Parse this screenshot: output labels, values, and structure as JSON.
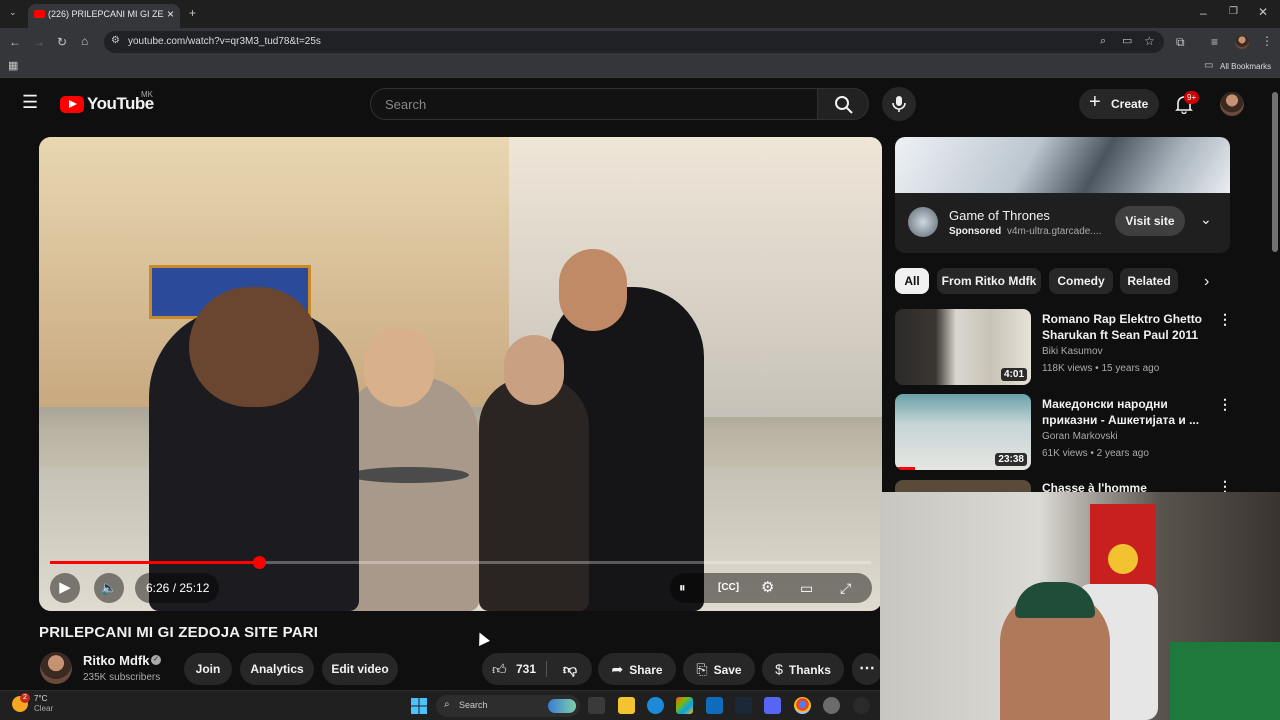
{
  "browser": {
    "tab_title": "(226) PRILEPCANI MI GI ZE",
    "url": "youtube.com/watch?v=qr3M3_tud78&t=25s",
    "bookmarks_label": "All Bookmarks"
  },
  "header": {
    "logo_text": "YouTube",
    "country_code": "MK",
    "search_placeholder": "Search",
    "create_label": "Create",
    "notification_badge": "9+"
  },
  "player": {
    "time": "6:26 / 25:12",
    "progress_fraction": 0.255
  },
  "video": {
    "title": "PRILEPCANI MI GI ZEDOJA SITE PARI",
    "channel_name": "Ritko Mdfk",
    "subscribers": "235K subscribers",
    "join_label": "Join",
    "analytics_label": "Analytics",
    "edit_label": "Edit video",
    "likes": "731",
    "share_label": "Share",
    "save_label": "Save",
    "thanks_label": "Thanks"
  },
  "ad": {
    "title": "Game of Thrones",
    "sponsored": "Sponsored",
    "url": "v4m-ultra.gtarcade....",
    "visit_label": "Visit site"
  },
  "chips": [
    "All",
    "From Ritko Mdfk",
    "Comedy",
    "Related"
  ],
  "related": [
    {
      "title": "Romano Rap Elektro Ghetto Sharukan ft Sean Paul 2011",
      "channel": "Biki Kasumov",
      "meta": "118K views • 15 years ago",
      "duration": "4:01",
      "watched_fraction": 0.0
    },
    {
      "title": "Македонски народни приказни - Ашкетијата и ...",
      "channel": "Goran Markovski",
      "meta": "61K views • 2 years ago",
      "duration": "23:38",
      "watched_fraction": 0.15
    },
    {
      "title": "Chasse à l'homme",
      "channel": "",
      "meta": "",
      "duration": "",
      "watched_fraction": 0.0
    }
  ],
  "taskbar": {
    "temperature": "7°C",
    "condition": "Clear",
    "weather_badge": "2",
    "search_placeholder": "Search"
  },
  "colors": {
    "accent": "#ff0000",
    "background": "#0f0f0f",
    "pill": "#272727"
  }
}
